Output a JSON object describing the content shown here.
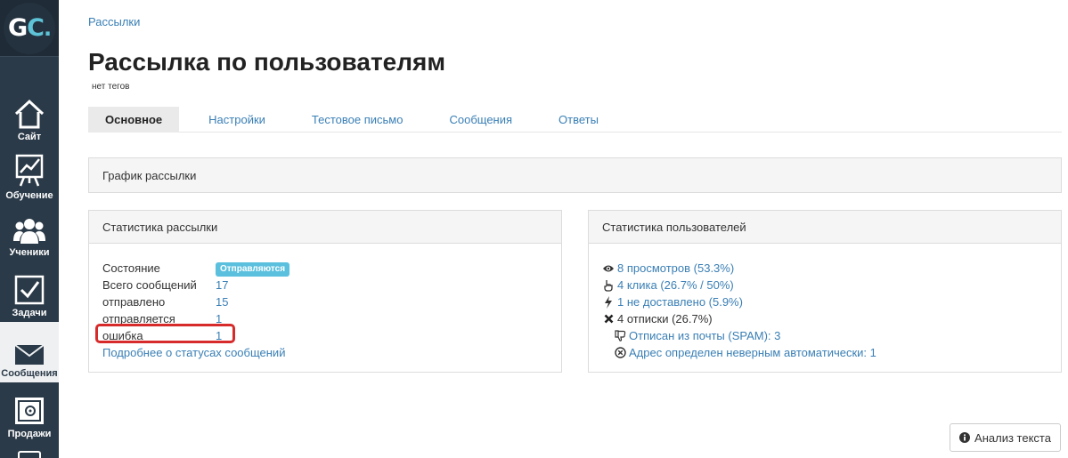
{
  "sidebar": {
    "logo": {
      "g": "G",
      "c": "C",
      "dot": "."
    },
    "items": [
      {
        "label": "Сайт",
        "icon": "home-icon"
      },
      {
        "label": "Обучение",
        "icon": "chart-board-icon"
      },
      {
        "label": "Ученики",
        "icon": "users-icon"
      },
      {
        "label": "Задачи",
        "icon": "checkbox-icon"
      },
      {
        "label": "Сообщения",
        "icon": "envelope-icon"
      },
      {
        "label": "Продажи",
        "icon": "safe-icon"
      }
    ]
  },
  "breadcrumb": "Рассылки",
  "title": "Рассылка по пользователям",
  "tags": "нет тегов",
  "tabs": [
    "Основное",
    "Настройки",
    "Тестовое письмо",
    "Сообщения",
    "Ответы"
  ],
  "schedule_panel": {
    "title": "График рассылки"
  },
  "stats_panel": {
    "title": "Статистика рассылки",
    "rows": [
      {
        "label": "Состояние",
        "badge": "Отправляются"
      },
      {
        "label": "Всего сообщений",
        "value": "17"
      },
      {
        "label": "отправлено",
        "value": "15"
      },
      {
        "label": "отправляется",
        "value": "1"
      },
      {
        "label": "ошибка",
        "value": "1"
      }
    ],
    "more_link": "Подробнее о статусах сообщений"
  },
  "users_panel": {
    "title": "Статистика пользователей",
    "views": "8 просмотров (53.3%)",
    "clicks": "4 клика (26.7% / 50%)",
    "not_delivered": "1 не доставлено (5.9%)",
    "unsubscribes": "4 отписки (26.7%)",
    "spam": "Отписан из почты (SPAM): 3",
    "invalid_address": "Адрес определен неверным автоматически: 1"
  },
  "analyze_button": "Анализ текста",
  "colors": {
    "accent": "#3a7fb5",
    "sidebar": "#2b3a48",
    "badge": "#5bc0de",
    "highlight": "#d72b2b"
  }
}
